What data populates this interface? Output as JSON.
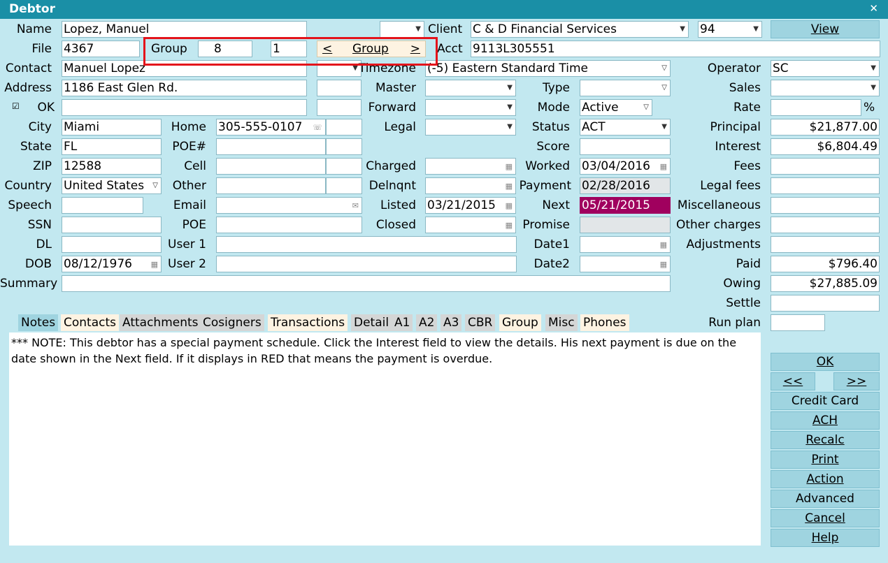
{
  "window": {
    "title": "Debtor",
    "close_icon": "close-icon"
  },
  "labels": {
    "name": "Name",
    "file": "File",
    "contact": "Contact",
    "address": "Address",
    "ok": "OK",
    "city": "City",
    "state": "State",
    "zip": "ZIP",
    "country": "Country",
    "speech": "Speech",
    "ssn": "SSN",
    "dl": "DL",
    "dob": "DOB",
    "summary": "Summary",
    "group": "Group",
    "home": "Home",
    "poe_num": "POE#",
    "cell": "Cell",
    "other": "Other",
    "email": "Email",
    "poe": "POE",
    "user1": "User 1",
    "user2": "User 2",
    "client": "Client",
    "acct": "Acct",
    "timezone": "Timezone",
    "master": "Master",
    "forward": "Forward",
    "legal": "Legal",
    "charged": "Charged",
    "delnqnt": "Delnqnt",
    "listed": "Listed",
    "closed": "Closed",
    "type": "Type",
    "mode": "Mode",
    "status": "Status",
    "score": "Score",
    "worked": "Worked",
    "payment": "Payment",
    "next": "Next",
    "promise": "Promise",
    "date1": "Date1",
    "date2": "Date2",
    "operator": "Operator",
    "sales": "Sales",
    "rate": "Rate",
    "principal": "Principal",
    "interest": "Interest",
    "fees": "Fees",
    "legal_fees": "Legal fees",
    "miscellaneous": "Miscellaneous",
    "other_charges": "Other charges",
    "adjustments": "Adjustments",
    "paid": "Paid",
    "owing": "Owing",
    "settle": "Settle",
    "run_plan": "Run plan",
    "rate_suffix": "%"
  },
  "fields": {
    "name": "Lopez, Manuel",
    "file": "4367",
    "contact": "Manuel Lopez",
    "address": "1186 East Glen Rd.",
    "address2": "",
    "city": "Miami",
    "state": "FL",
    "zip": "12588",
    "country": "United States",
    "speech": "",
    "ssn": "",
    "dl": "",
    "dob": "08/12/1976",
    "summary": "",
    "group_num": "8",
    "group_sub": "1",
    "home": "305-555-0107",
    "poe_num": "",
    "cell": "",
    "other": "",
    "email": "",
    "poe": "",
    "user1": "",
    "user2": "",
    "client": "C & D Financial Services",
    "client_code": "94",
    "acct": "9113L305551",
    "timezone": "(-5) Eastern Standard Time",
    "master": "",
    "forward": "",
    "legal": "",
    "charged": "",
    "delnqnt": "",
    "listed": "03/21/2015",
    "closed": "",
    "type": "",
    "mode": "Active",
    "status": "ACT",
    "score": "",
    "worked": "03/04/2016",
    "payment": "02/28/2016",
    "next": "05/21/2015",
    "promise": "",
    "date1": "",
    "date2": "",
    "operator": "SC",
    "sales": "",
    "rate": "",
    "principal": "$21,877.00",
    "interest": "$6,804.49",
    "fees": "",
    "legal_fees": "",
    "miscellaneous": "",
    "other_charges": "",
    "adjustments": "",
    "paid": "$796.40",
    "owing": "$27,885.09",
    "settle": "",
    "run_plan": ""
  },
  "group_nav": {
    "prev": "<",
    "label": "Group",
    "next": ">"
  },
  "tabs": [
    {
      "label": "Notes"
    },
    {
      "label": "Contacts"
    },
    {
      "label": "Attachments"
    },
    {
      "label": "Cosigners"
    },
    {
      "label": "Transactions"
    },
    {
      "label": "Detail"
    },
    {
      "label": "A1"
    },
    {
      "label": "A2"
    },
    {
      "label": "A3"
    },
    {
      "label": "CBR"
    },
    {
      "label": "Group"
    },
    {
      "label": "Misc"
    },
    {
      "label": "Phones"
    }
  ],
  "notes_text": "*** NOTE: This debtor has a special payment schedule. Click the Interest field to view the details. His next payment is due on the date shown in the Next field. If it displays in RED that means the payment is overdue.",
  "buttons": {
    "view": "View",
    "ok": "OK",
    "prev": "<<",
    "next": ">>",
    "credit_card": "Credit Card",
    "ach": "ACH",
    "recalc": "Recalc",
    "print": "Print",
    "action": "Action",
    "advanced": "Advanced",
    "cancel": "Cancel",
    "help": "Help"
  },
  "colors": {
    "background": "#c2e8f0",
    "titlebar": "#1a8fa6",
    "next_overdue": "#a0005e",
    "highlight_box": "#e4141b"
  }
}
